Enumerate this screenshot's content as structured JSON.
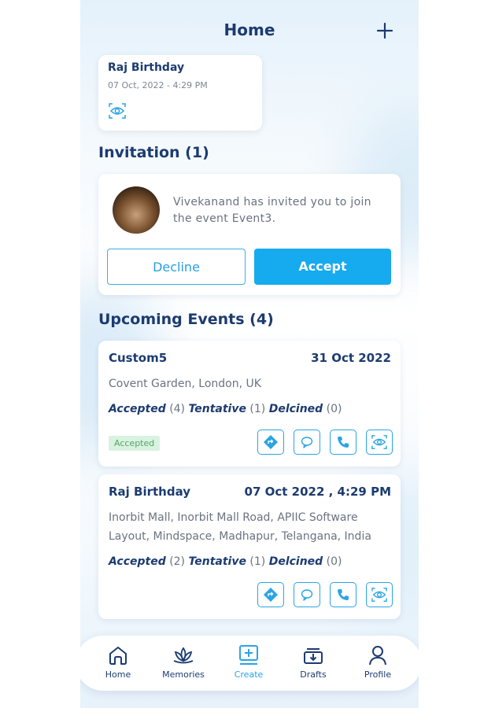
{
  "header": {
    "title": "Home"
  },
  "recent_card": {
    "title": "Raj Birthday",
    "datetime": "07 Oct, 2022 - 4:29 PM",
    "icon": "eye-scan-icon"
  },
  "invitation": {
    "heading": "Invitation (1)",
    "message": "Vivekanand has invited you to join the event Event3.",
    "decline_label": "Decline",
    "accept_label": "Accept"
  },
  "upcoming": {
    "heading": "Upcoming Events (4)",
    "events": [
      {
        "name": "Custom5",
        "date": "31 Oct 2022",
        "address": "Covent Garden, London, UK",
        "accepted_label": "Accepted",
        "accepted_count": "(4)",
        "tentative_label": "Tentative",
        "tentative_count": "(1)",
        "declined_label": "Delcined",
        "declined_count": "(0)",
        "badge": "Accepted"
      },
      {
        "name": "Raj Birthday",
        "date": "07 Oct 2022 , 4:29 PM",
        "address": "Inorbit Mall, Inorbit Mall Road, APIIC Software Layout, Mindspace, Madhapur, Telangana, India",
        "accepted_label": "Accepted",
        "accepted_count": "(2)",
        "tentative_label": "Tentative",
        "tentative_count": "(1)",
        "declined_label": "Delcined",
        "declined_count": "(0)"
      }
    ],
    "action_icons": [
      "directions-icon",
      "chat-icon",
      "phone-icon",
      "eye-scan-icon"
    ]
  },
  "nav": {
    "items": [
      {
        "label": "Home",
        "icon": "home-icon"
      },
      {
        "label": "Memories",
        "icon": "lotus-icon"
      },
      {
        "label": "Create",
        "icon": "add-square-icon",
        "active": true
      },
      {
        "label": "Drafts",
        "icon": "drafts-tray-icon"
      },
      {
        "label": "Profile",
        "icon": "profile-icon"
      }
    ]
  },
  "colors": {
    "primary_text": "#1c3b71",
    "accent": "#16aaef",
    "badge_bg": "#daf2e0",
    "badge_text": "#4ca868"
  }
}
